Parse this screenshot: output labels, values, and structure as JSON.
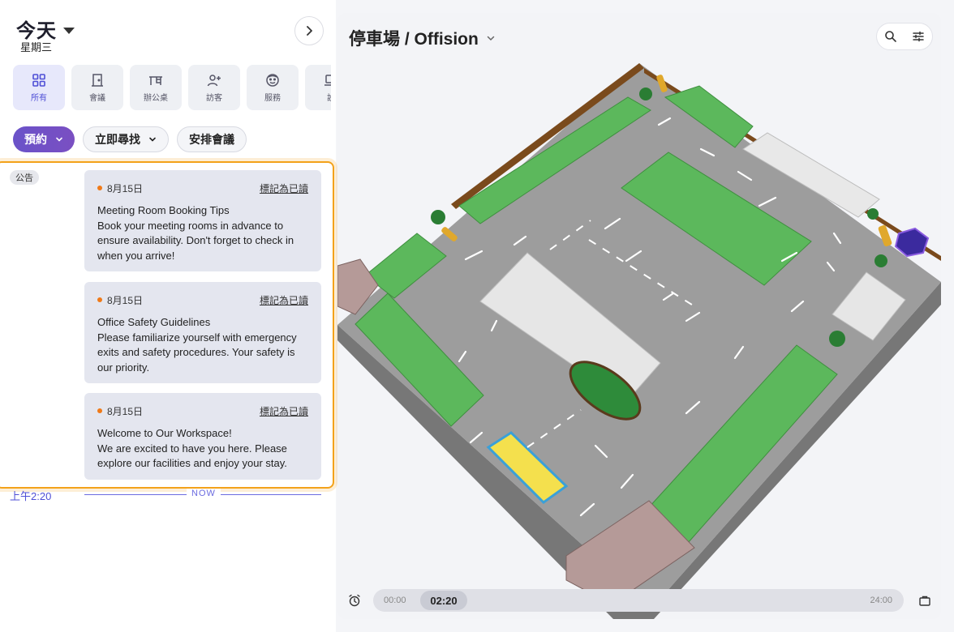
{
  "header": {
    "title": "今天",
    "weekday": "星期三"
  },
  "categories": [
    {
      "label": "所有",
      "icon": "grid-icon",
      "active": true
    },
    {
      "label": "會議",
      "icon": "door-icon",
      "active": false
    },
    {
      "label": "辦公桌",
      "icon": "desk-icon",
      "active": false
    },
    {
      "label": "訪客",
      "icon": "add-person-icon",
      "active": false
    },
    {
      "label": "服務",
      "icon": "face-icon",
      "active": false
    },
    {
      "label": "設",
      "icon": "device-icon",
      "active": false
    }
  ],
  "actions": {
    "book": "預約",
    "find_now": "立即尋找",
    "schedule": "安排會議"
  },
  "announcements": {
    "tag": "公告",
    "items": [
      {
        "date": "8月15日",
        "mark_read": "標記為已讀",
        "title": "Meeting Room Booking Tips",
        "body": "Book your meeting rooms in advance to ensure availability. Don't forget to check in when you arrive!"
      },
      {
        "date": "8月15日",
        "mark_read": "標記為已讀",
        "title": "Office Safety Guidelines",
        "body": "Please familiarize yourself with emergency exits and safety procedures. Your safety is our priority."
      },
      {
        "date": "8月15日",
        "mark_read": "標記為已讀",
        "title": "Welcome to Our Workspace!",
        "body": "We are excited to have you here. Please explore our facilities and enjoy your stay."
      }
    ]
  },
  "now_marker": {
    "time": "上午2:20",
    "label": "NOW"
  },
  "map": {
    "title": "停車場 / Offision"
  },
  "timeline": {
    "start": "00:00",
    "current": "02:20",
    "end": "24:00"
  },
  "colors": {
    "accent": "#4f4fd6",
    "highlight": "#f3a21a",
    "parking": "#5cb85c",
    "asphalt": "#9b9b9b"
  }
}
